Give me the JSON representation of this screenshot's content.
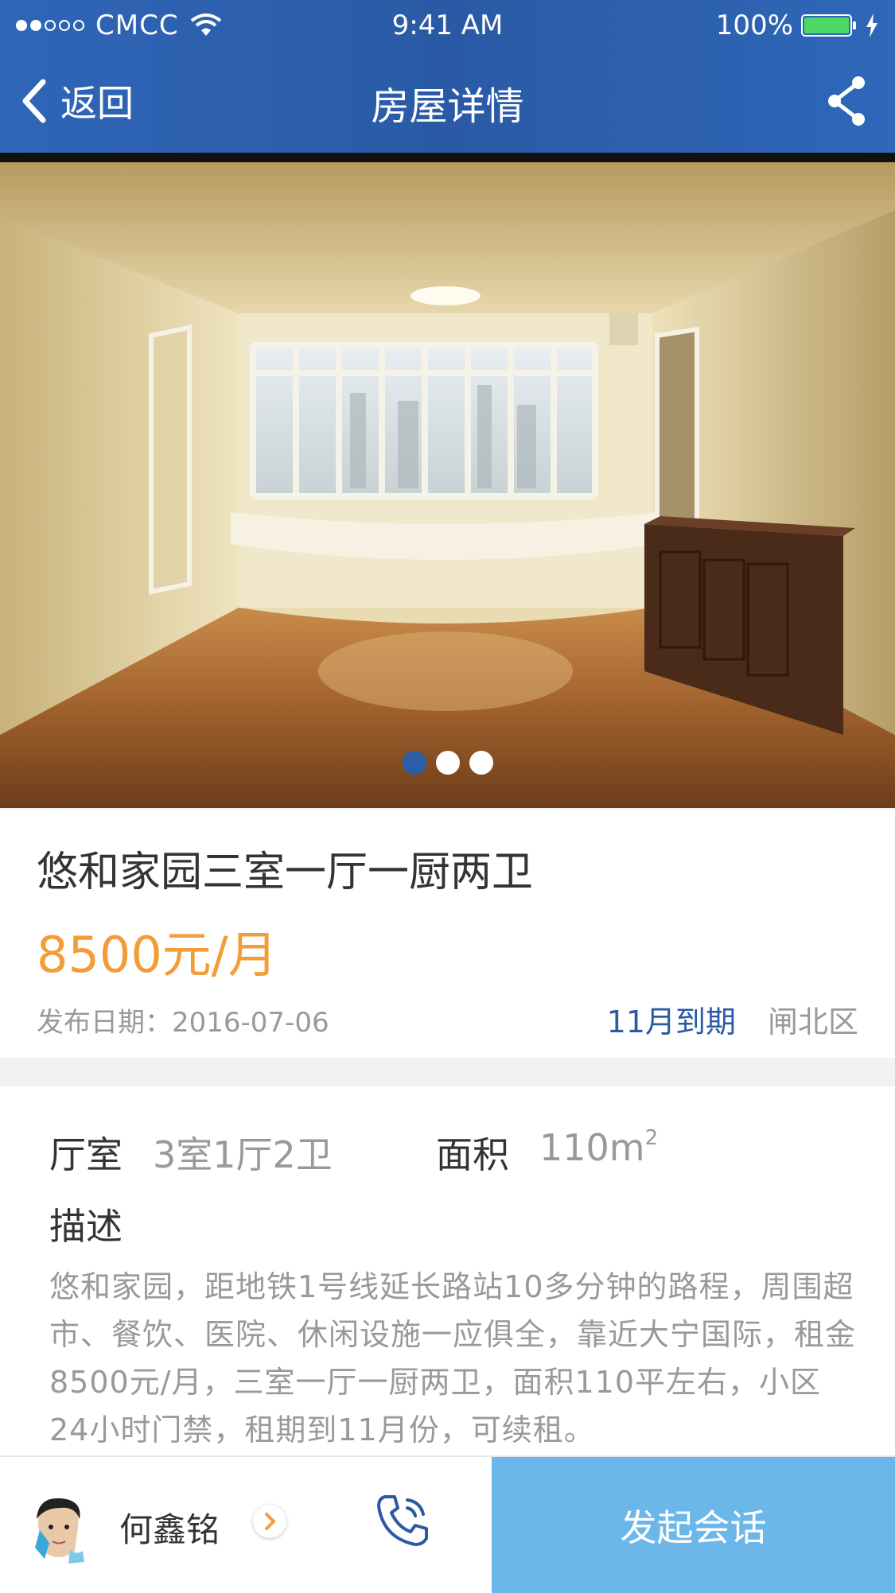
{
  "status_bar": {
    "carrier": "CMCC",
    "time": "9:41 AM",
    "battery": "100%"
  },
  "nav": {
    "back_label": "返回",
    "title": "房屋详情"
  },
  "carousel": {
    "page_count": 3,
    "active_index": 0
  },
  "listing": {
    "title": "悠和家园三室一厅一厨两卫",
    "price": "8500元/月",
    "publish_date": "发布日期：2016-07-06",
    "expiry": "11月到期",
    "district": "闸北区"
  },
  "details": {
    "layout_label": "厅室",
    "layout_value": "3室1厅2卫",
    "area_label": "面积",
    "area_value": "110m",
    "area_unit_sup": "2",
    "description_label": "描述",
    "description": "悠和家园，距地铁1号线延长路站10多分钟的路程，周围超市、餐饮、医院、休闲设施一应俱全，靠近大宁国际，租金8500元/月，三室一厅一厨两卫，面积110平左右，小区24小时门禁，租期到11月份，可续租。"
  },
  "bottom_bar": {
    "agent_name": "何鑫铭",
    "chat_label": "发起会话"
  },
  "colors": {
    "header_blue": "#2a5aa5",
    "price_orange": "#f29d38",
    "chat_button": "#6cb7ea"
  }
}
